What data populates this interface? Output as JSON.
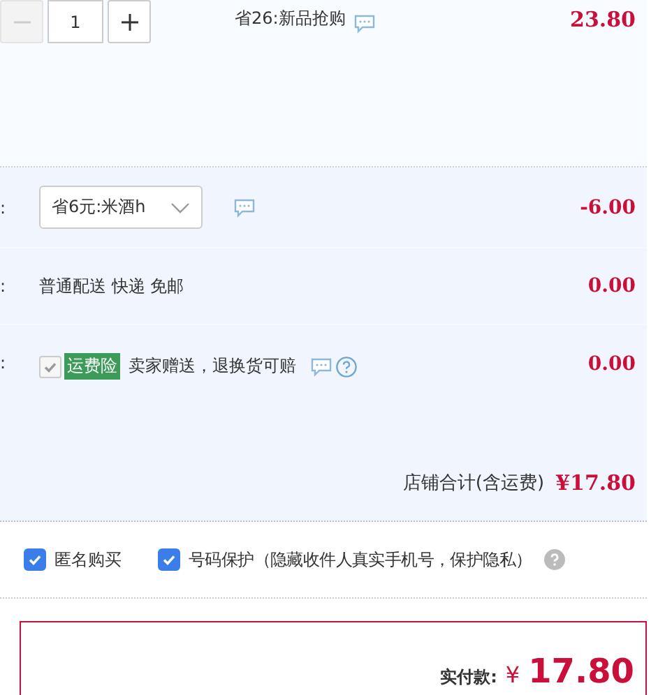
{
  "item": {
    "quantity": "1",
    "minus_disabled": true,
    "promo": "省26:新品抢购",
    "price": "23.80"
  },
  "rows": [
    {
      "kind": "select",
      "label": ":",
      "value": "省6元:米酒h",
      "amount": "-6.00"
    },
    {
      "kind": "text",
      "label": ":",
      "text": "普通配送 快递 免邮",
      "amount": "0.00"
    },
    {
      "kind": "insurance",
      "label": ":",
      "checked": true,
      "disabled": true,
      "tag": "运费险",
      "text": "卖家赠送，退换货可赔",
      "amount": "0.00"
    }
  ],
  "shop_total": {
    "label": "店铺合计(含运费)",
    "amount": "¥17.80"
  },
  "options": [
    {
      "label": "匿名购买",
      "checked": true
    },
    {
      "label": "号码保护（隐藏收件人真实手机号，保护隐私）",
      "checked": true
    }
  ],
  "payment": {
    "label": "实付款:",
    "currency": "¥",
    "amount": "17.80"
  }
}
